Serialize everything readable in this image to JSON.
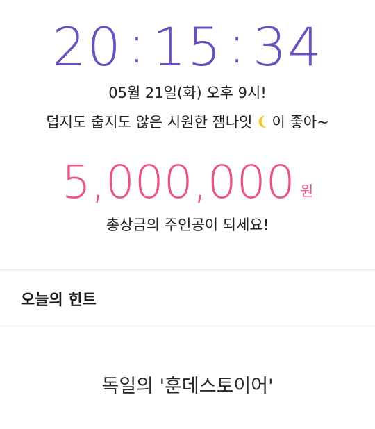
{
  "clock": {
    "hours": "20",
    "minutes": "15",
    "seconds": "34",
    "separator": ":",
    "color": "#6a4fbf"
  },
  "event": {
    "date_line": "05월 21일(화) 오후 9시!",
    "desc_before_icon": "덥지도 춥지도 않은 시원한 잼나잇",
    "icon": "crescent-moon-icon",
    "desc_after_icon": "이 좋아~"
  },
  "prize": {
    "amount": "5,000,000",
    "unit": "원",
    "subtitle": "총상금의 주인공이 되세요!",
    "color": "#e8557e"
  },
  "hint": {
    "title": "오늘의 힌트",
    "text": "독일의 '훈데스토이어'"
  }
}
